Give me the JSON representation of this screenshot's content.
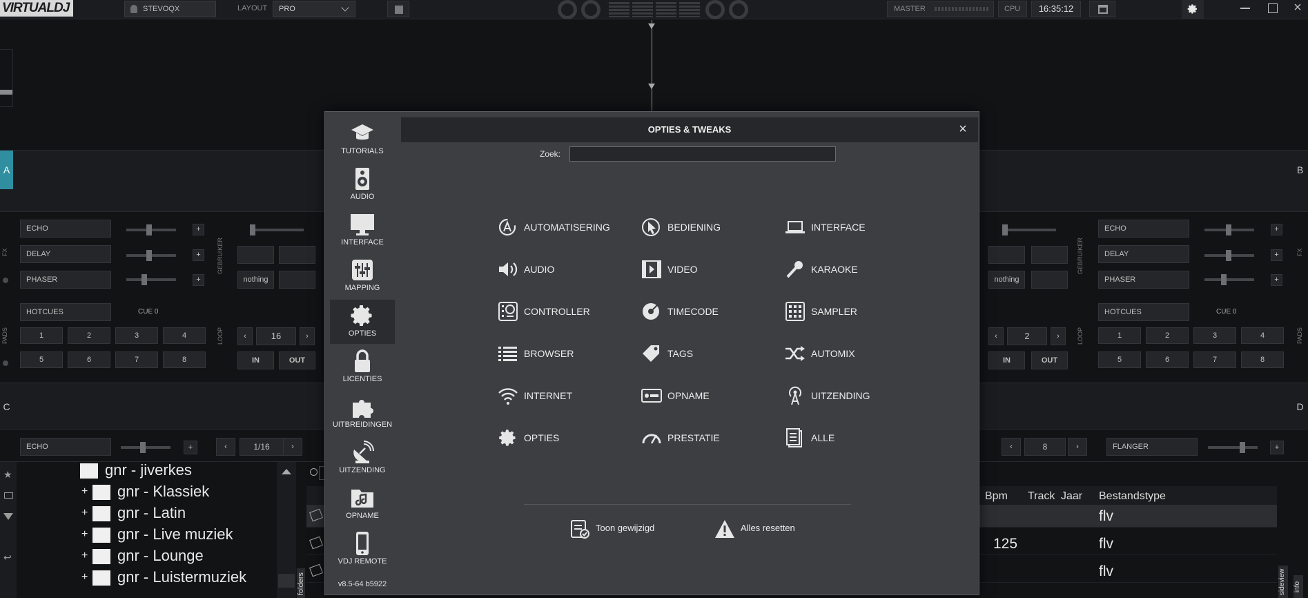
{
  "topbar": {
    "logo": "VIRTUALDJ",
    "user": "STEVOQX",
    "layout_label": "LAYOUT",
    "layout_value": "PRO",
    "master_label": "MASTER",
    "cpu_label": "CPU",
    "clock": "16:35:12"
  },
  "decks": {
    "a": "A",
    "b": "B",
    "c": "C",
    "d": "D",
    "fx_label": "FX",
    "gebruiker_label": "GEBRUIKER",
    "pads_label": "PADS",
    "loop_label": "LOOP",
    "left_fx": [
      "ECHO",
      "DELAY",
      "PHASER"
    ],
    "right_fx": [
      "ECHO",
      "DELAY",
      "PHASER"
    ],
    "left_user_slot": "nothing",
    "right_user_slot": "nothing",
    "hotcues": "HOTCUES",
    "cue": "CUE 0",
    "pads_top": [
      "1",
      "2",
      "3",
      "4"
    ],
    "pads_bottom": [
      "5",
      "6",
      "7",
      "8"
    ],
    "left_loop": "16",
    "right_loop": "2",
    "in": "IN",
    "out": "OUT",
    "c_fx": "ECHO",
    "c_loop": "1/16",
    "d_loop": "8",
    "d_fx": "FLANGER"
  },
  "browser": {
    "tree": [
      {
        "label": "gnr - jiverkes",
        "expand": ""
      },
      {
        "label": "gnr - Klassiek",
        "expand": "+"
      },
      {
        "label": "gnr - Latin",
        "expand": "+"
      },
      {
        "label": "gnr - Live muziek",
        "expand": "+"
      },
      {
        "label": "gnr - Lounge",
        "expand": "+"
      },
      {
        "label": "gnr - Luistermuziek",
        "expand": "+"
      }
    ],
    "folders_tab": "folders",
    "sideview_tab": "sideview",
    "info_tab": "info",
    "columns": {
      "bpm": "Bpm",
      "track": "Track",
      "year": "Jaar",
      "filetype": "Bestandstype"
    },
    "rows": [
      {
        "bpm": "",
        "filetype": "flv"
      },
      {
        "bpm": "125",
        "filetype": "flv"
      },
      {
        "bpm": "",
        "filetype": "flv"
      }
    ]
  },
  "dialog": {
    "title": "OPTIES & TWEAKS",
    "close": "×",
    "search_label": "Zoek:",
    "search_value": "",
    "nav": [
      {
        "label": "TUTORIALS",
        "icon": "graduation-cap-icon"
      },
      {
        "label": "AUDIO",
        "icon": "speaker-icon"
      },
      {
        "label": "INTERFACE",
        "icon": "monitor-icon"
      },
      {
        "label": "MAPPING",
        "icon": "sliders-icon"
      },
      {
        "label": "OPTIES",
        "icon": "gear-icon"
      },
      {
        "label": "LICENTIES",
        "icon": "lock-icon"
      },
      {
        "label": "UITBREIDINGEN",
        "icon": "puzzle-icon"
      },
      {
        "label": "UITZENDING",
        "icon": "satellite-dish-icon"
      },
      {
        "label": "OPNAME",
        "icon": "music-folder-icon"
      },
      {
        "label": "VDJ REMOTE",
        "icon": "phone-icon"
      }
    ],
    "version": "v8.5-64 b5922",
    "options": [
      [
        "AUTOMATISERING",
        "BEDIENING",
        "INTERFACE"
      ],
      [
        "AUDIO",
        "VIDEO",
        "KARAOKE"
      ],
      [
        "CONTROLLER",
        "TIMECODE",
        "SAMPLER"
      ],
      [
        "BROWSER",
        "TAGS",
        "AUTOMIX"
      ],
      [
        "INTERNET",
        "OPNAME",
        "UITZENDING"
      ],
      [
        "OPTIES",
        "PRESTATIE",
        "ALLE"
      ]
    ],
    "show_changed": "Toon gewijzigd",
    "reset_all": "Alles resetten"
  },
  "colors": {
    "accent_deck_a": "#2f8fa0",
    "highlight_arrow": "#f5f0c0"
  }
}
